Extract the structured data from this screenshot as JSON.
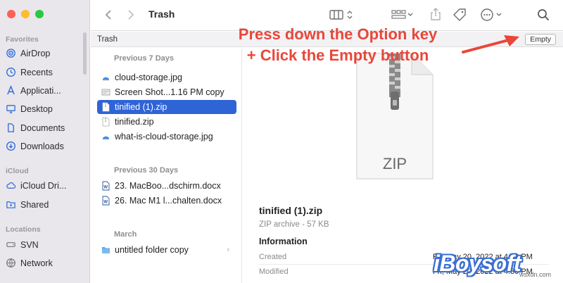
{
  "sidebar": {
    "favorites_header": "Favorites",
    "favorites": [
      {
        "label": "AirDrop",
        "icon": "airdrop-icon"
      },
      {
        "label": "Recents",
        "icon": "clock-icon"
      },
      {
        "label": "Applicati...",
        "icon": "applications-icon"
      },
      {
        "label": "Desktop",
        "icon": "desktop-icon"
      },
      {
        "label": "Documents",
        "icon": "document-icon"
      },
      {
        "label": "Downloads",
        "icon": "download-icon"
      }
    ],
    "icloud_header": "iCloud",
    "icloud": [
      {
        "label": "iCloud Dri...",
        "icon": "cloud-icon"
      },
      {
        "label": "Shared",
        "icon": "shared-folder-icon"
      }
    ],
    "locations_header": "Locations",
    "locations": [
      {
        "label": "SVN",
        "icon": "drive-icon"
      },
      {
        "label": "Network",
        "icon": "network-icon"
      }
    ]
  },
  "toolbar": {
    "title": "Trash"
  },
  "pathbar": {
    "label": "Trash",
    "empty_button": "Empty"
  },
  "filelist": {
    "groups": [
      {
        "header": "Previous 7 Days",
        "items": [
          {
            "name": "cloud-storage.jpg",
            "icon": "image-file-icon",
            "selected": false
          },
          {
            "name": "Screen Shot...1.16 PM copy",
            "icon": "screenshot-file-icon",
            "selected": false
          },
          {
            "name": "tinified (1).zip",
            "icon": "zip-file-icon",
            "selected": true
          },
          {
            "name": "tinified.zip",
            "icon": "zip-file-icon",
            "selected": false
          },
          {
            "name": "what-is-cloud-storage.jpg",
            "icon": "image-file-icon",
            "selected": false
          }
        ]
      },
      {
        "header": "Previous 30 Days",
        "items": [
          {
            "name": "23. MacBoo...dschirm.docx",
            "icon": "word-file-icon",
            "selected": false
          },
          {
            "name": "26. Mac M1 l...chalten.docx",
            "icon": "word-file-icon",
            "selected": false
          }
        ]
      },
      {
        "header": "March",
        "items": [
          {
            "name": "untitled folder copy",
            "icon": "folder-icon",
            "selected": false
          }
        ]
      }
    ]
  },
  "preview": {
    "big_icon_label": "ZIP",
    "filename": "tinified (1).zip",
    "subtitle": "ZIP archive - 57 KB",
    "info_header": "Information",
    "rows": [
      {
        "label": "Created",
        "value": "Fri, May 20, 2022 at 4:30 PM"
      },
      {
        "label": "Modified",
        "value": "Fri, May 20, 2022 at 4:30 PM"
      }
    ]
  },
  "annotation": {
    "line1": "Press down the Option key",
    "line2": "+ Click the Empty button"
  },
  "watermark": {
    "brand": "iBoysoft",
    "site": "wsxdn.com"
  },
  "colors": {
    "selection": "#2f64d6",
    "annotation": "#e8473a",
    "sidebar_icon": "#2f6bd6"
  }
}
